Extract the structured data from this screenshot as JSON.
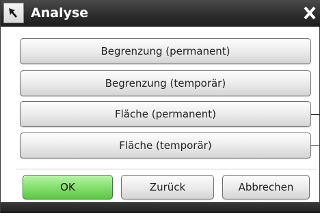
{
  "window": {
    "title": "Analyse",
    "title_icon": "arrow-pointer-icon",
    "close_icon": "close-icon"
  },
  "options": [
    {
      "label": "Begrenzung (permanent)"
    },
    {
      "label": "Begrenzung (temporär)"
    },
    {
      "label": "Fläche (permanent)"
    },
    {
      "label": "Fläche (temporär)"
    }
  ],
  "footer": {
    "ok_label": "OK",
    "back_label": "Zurück",
    "cancel_label": "Abbrechen"
  },
  "colors": {
    "titlebar": "#2c2c2c",
    "ok_button": "#86e06e"
  }
}
